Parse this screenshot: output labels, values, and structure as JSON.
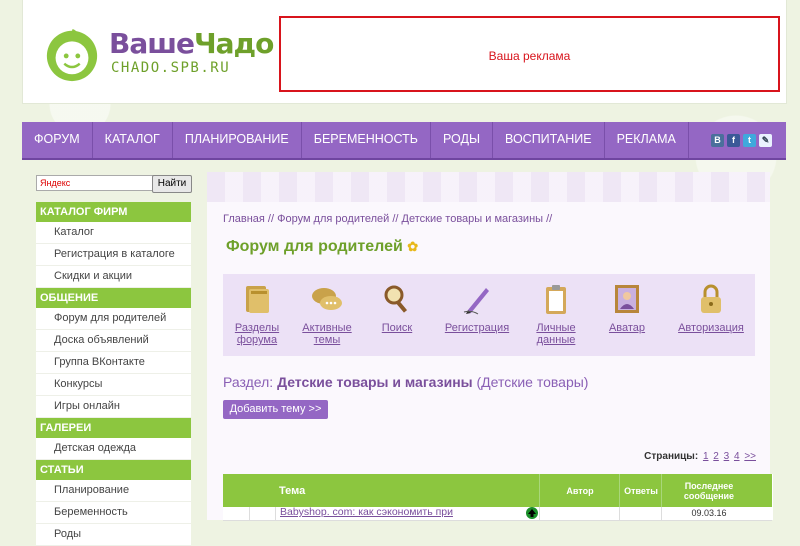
{
  "header": {
    "logo_title_part1": "Ваше",
    "logo_title_part2": "Чадо",
    "logo_subtitle": "CHADO.SPB.RU",
    "ad_text": "Ваша реклама"
  },
  "nav": {
    "items": [
      "ФОРУМ",
      "КАТАЛОГ",
      "ПЛАНИРОВАНИЕ",
      "БЕРЕМЕННОСТЬ",
      "РОДЫ",
      "ВОСПИТАНИЕ",
      "РЕКЛАМА"
    ],
    "social": [
      "В",
      "f",
      "t",
      "✎"
    ]
  },
  "search": {
    "placeholder": "Яндекс",
    "button": "Найти"
  },
  "sidebar": {
    "sections": [
      {
        "title": "КАТАЛОГ ФИРМ",
        "items": [
          "Каталог",
          "Регистрация в каталоге",
          "Скидки и акции"
        ]
      },
      {
        "title": "ОБЩЕНИЕ",
        "items": [
          "Форум для родителей",
          "Доска объявлений",
          "Группа ВКонтакте",
          "Конкурсы",
          "Игры онлайн"
        ]
      },
      {
        "title": "ГАЛЕРЕИ",
        "items": [
          "Детская одежда"
        ]
      },
      {
        "title": "СТАТЬИ",
        "items": [
          "Планирование",
          "Беременность",
          "Роды"
        ]
      }
    ]
  },
  "main": {
    "breadcrumb": "Главная // Форум для родителей // Детские товары и магазины //",
    "title": "Форум для родителей",
    "iconbar": [
      {
        "label": "Разделы форума",
        "icon": "books-icon"
      },
      {
        "label": "Активные темы",
        "icon": "chat-bubbles-icon"
      },
      {
        "label": "Поиск",
        "icon": "search-icon"
      },
      {
        "label": "Регистрация",
        "icon": "pen-icon"
      },
      {
        "label": "Личные данные",
        "icon": "clipboard-icon"
      },
      {
        "label": "Аватар",
        "icon": "portrait-icon"
      },
      {
        "label": "Авторизация",
        "icon": "lock-icon"
      }
    ],
    "section_prefix": "Раздел:",
    "section_name": "Детские товары и магазины",
    "section_extra": "(Детские товары)",
    "add_topic": "Добавить тему >>",
    "pages_label": "Страницы:",
    "pages": [
      "1",
      "2",
      "3",
      "4",
      ">>"
    ],
    "table": {
      "headers": [
        "Тема",
        "Автор",
        "Ответы",
        "Последнее сообщение"
      ],
      "rows": [
        {
          "topic": "Babyshop. com: как сэкономить при",
          "last": "09.03.16"
        }
      ]
    }
  }
}
